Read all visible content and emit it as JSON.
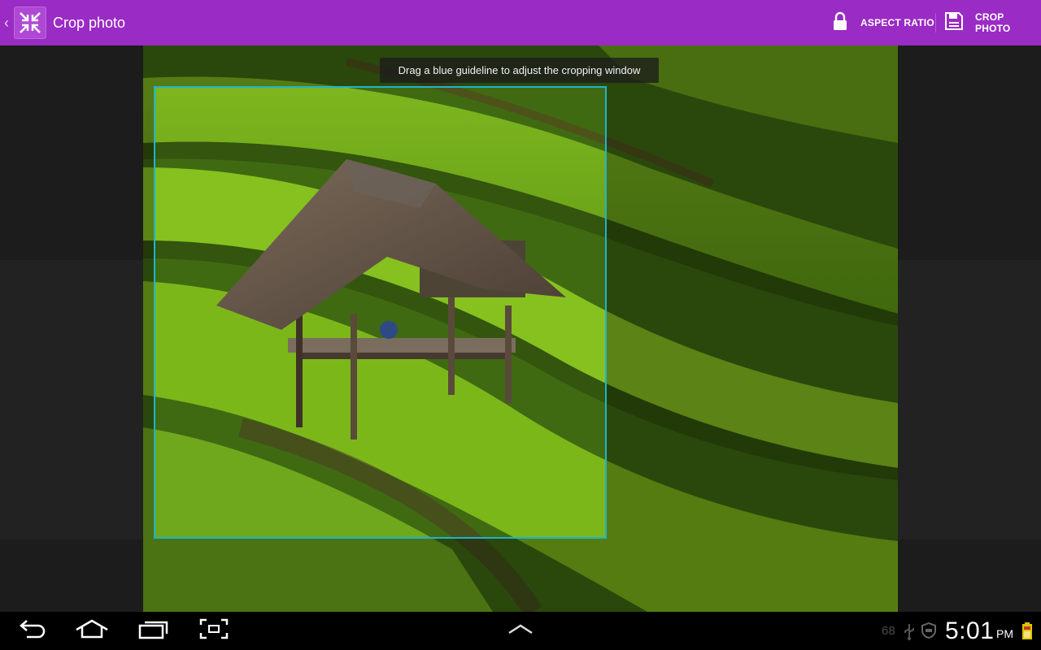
{
  "actionbar": {
    "title": "Crop photo",
    "actions": [
      {
        "label": "ASPECT RATIO",
        "icon": "lock-icon"
      },
      {
        "label": "CROP PHOTO",
        "icon": "save-icon"
      }
    ],
    "background": "#9a2bc4"
  },
  "editor": {
    "hint": "Drag a blue guideline to adjust the cropping window",
    "guideline_color": "#1fb3cf"
  },
  "system_bar": {
    "nav_icons": [
      "back-icon",
      "home-icon",
      "recent-apps-icon",
      "screenshot-icon",
      "up-arrow-icon"
    ],
    "status": {
      "battery_level_text": "68",
      "icons": [
        "usb-icon",
        "shield-icon",
        "battery-icon"
      ],
      "time": "5:01",
      "ampm": "PM"
    }
  }
}
